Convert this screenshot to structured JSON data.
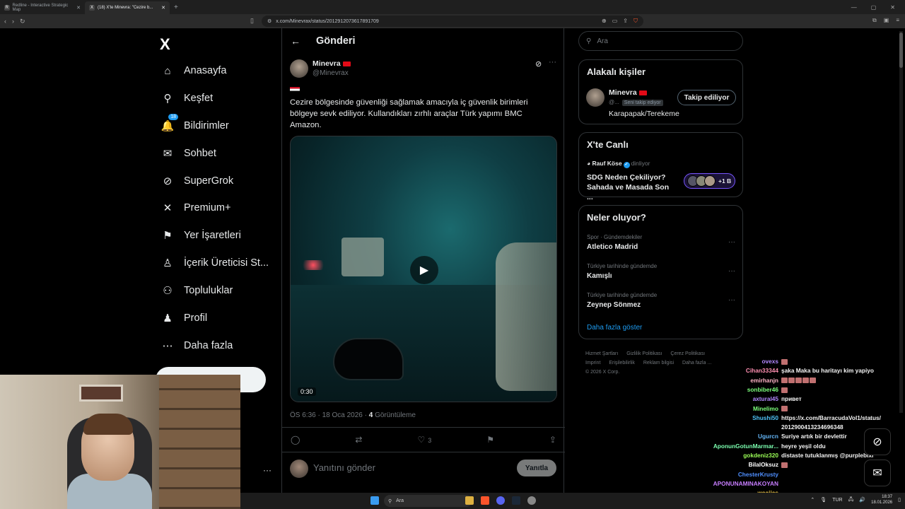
{
  "browser": {
    "tabs": [
      {
        "label": "Redline - Interactive Strategic Map",
        "favicon": "R"
      },
      {
        "label": "(18) X'te Minevra: \"Cezire b...",
        "favicon": "X"
      }
    ],
    "url": "x.com/Minevrax/status/2012912073617891709"
  },
  "nav": {
    "logo": "X",
    "items": [
      {
        "label": "Anasayfa",
        "icon": "home-icon",
        "glyph": "⌂"
      },
      {
        "label": "Keşfet",
        "icon": "search-icon",
        "glyph": "⚲"
      },
      {
        "label": "Bildirimler",
        "icon": "bell-icon",
        "glyph": "🔔",
        "badge": "18"
      },
      {
        "label": "Sohbet",
        "icon": "mail-icon",
        "glyph": "✉"
      },
      {
        "label": "SuperGrok",
        "icon": "grok-icon",
        "glyph": "⊘"
      },
      {
        "label": "Premium+",
        "icon": "x-premium-icon",
        "glyph": "✕"
      },
      {
        "label": "Yer İşaretleri",
        "icon": "bookmark-icon",
        "glyph": "⚑"
      },
      {
        "label": "İçerik Üreticisi St...",
        "icon": "creator-icon",
        "glyph": "♙"
      },
      {
        "label": "Topluluklar",
        "icon": "communities-icon",
        "glyph": "⚇"
      },
      {
        "label": "Profil",
        "icon": "profile-icon",
        "glyph": "♟"
      },
      {
        "label": "Daha fazla",
        "icon": "more-circle-icon",
        "glyph": "⋯"
      }
    ],
    "more": "···"
  },
  "post": {
    "header_title": "Gönderi",
    "author_name": "Minevra",
    "author_handle": "@Minevrax",
    "text": "Cezire bölgesinde güvenliği sağlamak amacıyla iç güvenlik birimleri bölgeye sevk ediliyor. Kullandıkları zırhlı araçlar Türk yapımı BMC Amazon.",
    "video_time": "0:30",
    "meta_time": "ÖS 6:36 · 18 Oca 2026 · ",
    "views": "4",
    "views_label": " Görüntüleme",
    "likes": "3",
    "reply_placeholder": "Yanıtını gönder",
    "reply_button": "Yanıtla"
  },
  "right": {
    "search_placeholder": "Ara",
    "related_title": "Alakalı kişiler",
    "related": {
      "name": "Minevra",
      "handle": "@...",
      "follows_you": "Seni takip ediyor",
      "follow_btn": "Takip ediliyor",
      "bio": "Karapapak/Terekeme"
    },
    "live_title": "X'te Canlı",
    "live": {
      "host": "Rauf Köse",
      "status": "dinliyor",
      "title": "SDG Neden Çekiliyor? Sahada ve Masada Son ...",
      "count": "+1 B"
    },
    "trends_title": "Neler oluyor?",
    "trends": [
      {
        "category": "Spor · Gündemdekiler",
        "name": "Atletico Madrid"
      },
      {
        "category": "Türkiye tarihinde gündemde",
        "name": "Kamışlı"
      },
      {
        "category": "Türkiye tarihinde gündemde",
        "name": "Zeynep Sönmez"
      }
    ],
    "show_more": "Daha fazla göster",
    "footer": [
      "Hizmet Şartları",
      "Gizlilik Politikası",
      "Çerez Politikası",
      "Imprint",
      "Erişilebilirlik",
      "Reklam bilgisi",
      "Daha fazla ...",
      "© 2026 X Corp."
    ]
  },
  "chat": [
    {
      "user": "ovexs",
      "color": "#b388ff",
      "text": "",
      "emote": true
    },
    {
      "user": "Cihan33344",
      "color": "#ff8fb1",
      "text": "şaka Maka bu haritayı kim yapiyo"
    },
    {
      "user": "emirhanjn",
      "color": "#ffb3c6",
      "text": "",
      "emote": true
    },
    {
      "user": "sonbiber46",
      "color": "#7cff7c",
      "text": "",
      "emote": true
    },
    {
      "user": "axtural45",
      "color": "#b388ff",
      "text": "привет"
    },
    {
      "user": "Minelimo",
      "color": "#7cff7c",
      "text": "",
      "emote": true
    },
    {
      "user": "Shushi50",
      "color": "#4fc3f7",
      "text": "https://x.com/BarracudaVol1/status/"
    },
    {
      "user": "",
      "color": "#ffffff",
      "text": "2012900413234696348"
    },
    {
      "user": "Ugurcn",
      "color": "#64b5f6",
      "text": "Suriye artık bir devlettir"
    },
    {
      "user": "AponunGotunMarmar...",
      "color": "#7cffb0",
      "text": "heyre yeşil oldu"
    },
    {
      "user": "gokdeniz320",
      "color": "#9cff57",
      "text": "distaste tutuklanmış @purplebixi"
    },
    {
      "user": "BilalOksuz",
      "color": "#ffffff",
      "text": "",
      "emote": true
    },
    {
      "user": "ChesterKrusty",
      "color": "#4f8fff",
      "text": ""
    },
    {
      "user": "APONUNAMINAKOYAN",
      "color": "#c77dff",
      "text": ""
    },
    {
      "user": "weajjas",
      "color": "#ffd54f",
      "text": ""
    }
  ],
  "taskbar": {
    "search": "Ara",
    "lang": "TUR",
    "time": "18:37",
    "date": "18.01.2026"
  }
}
